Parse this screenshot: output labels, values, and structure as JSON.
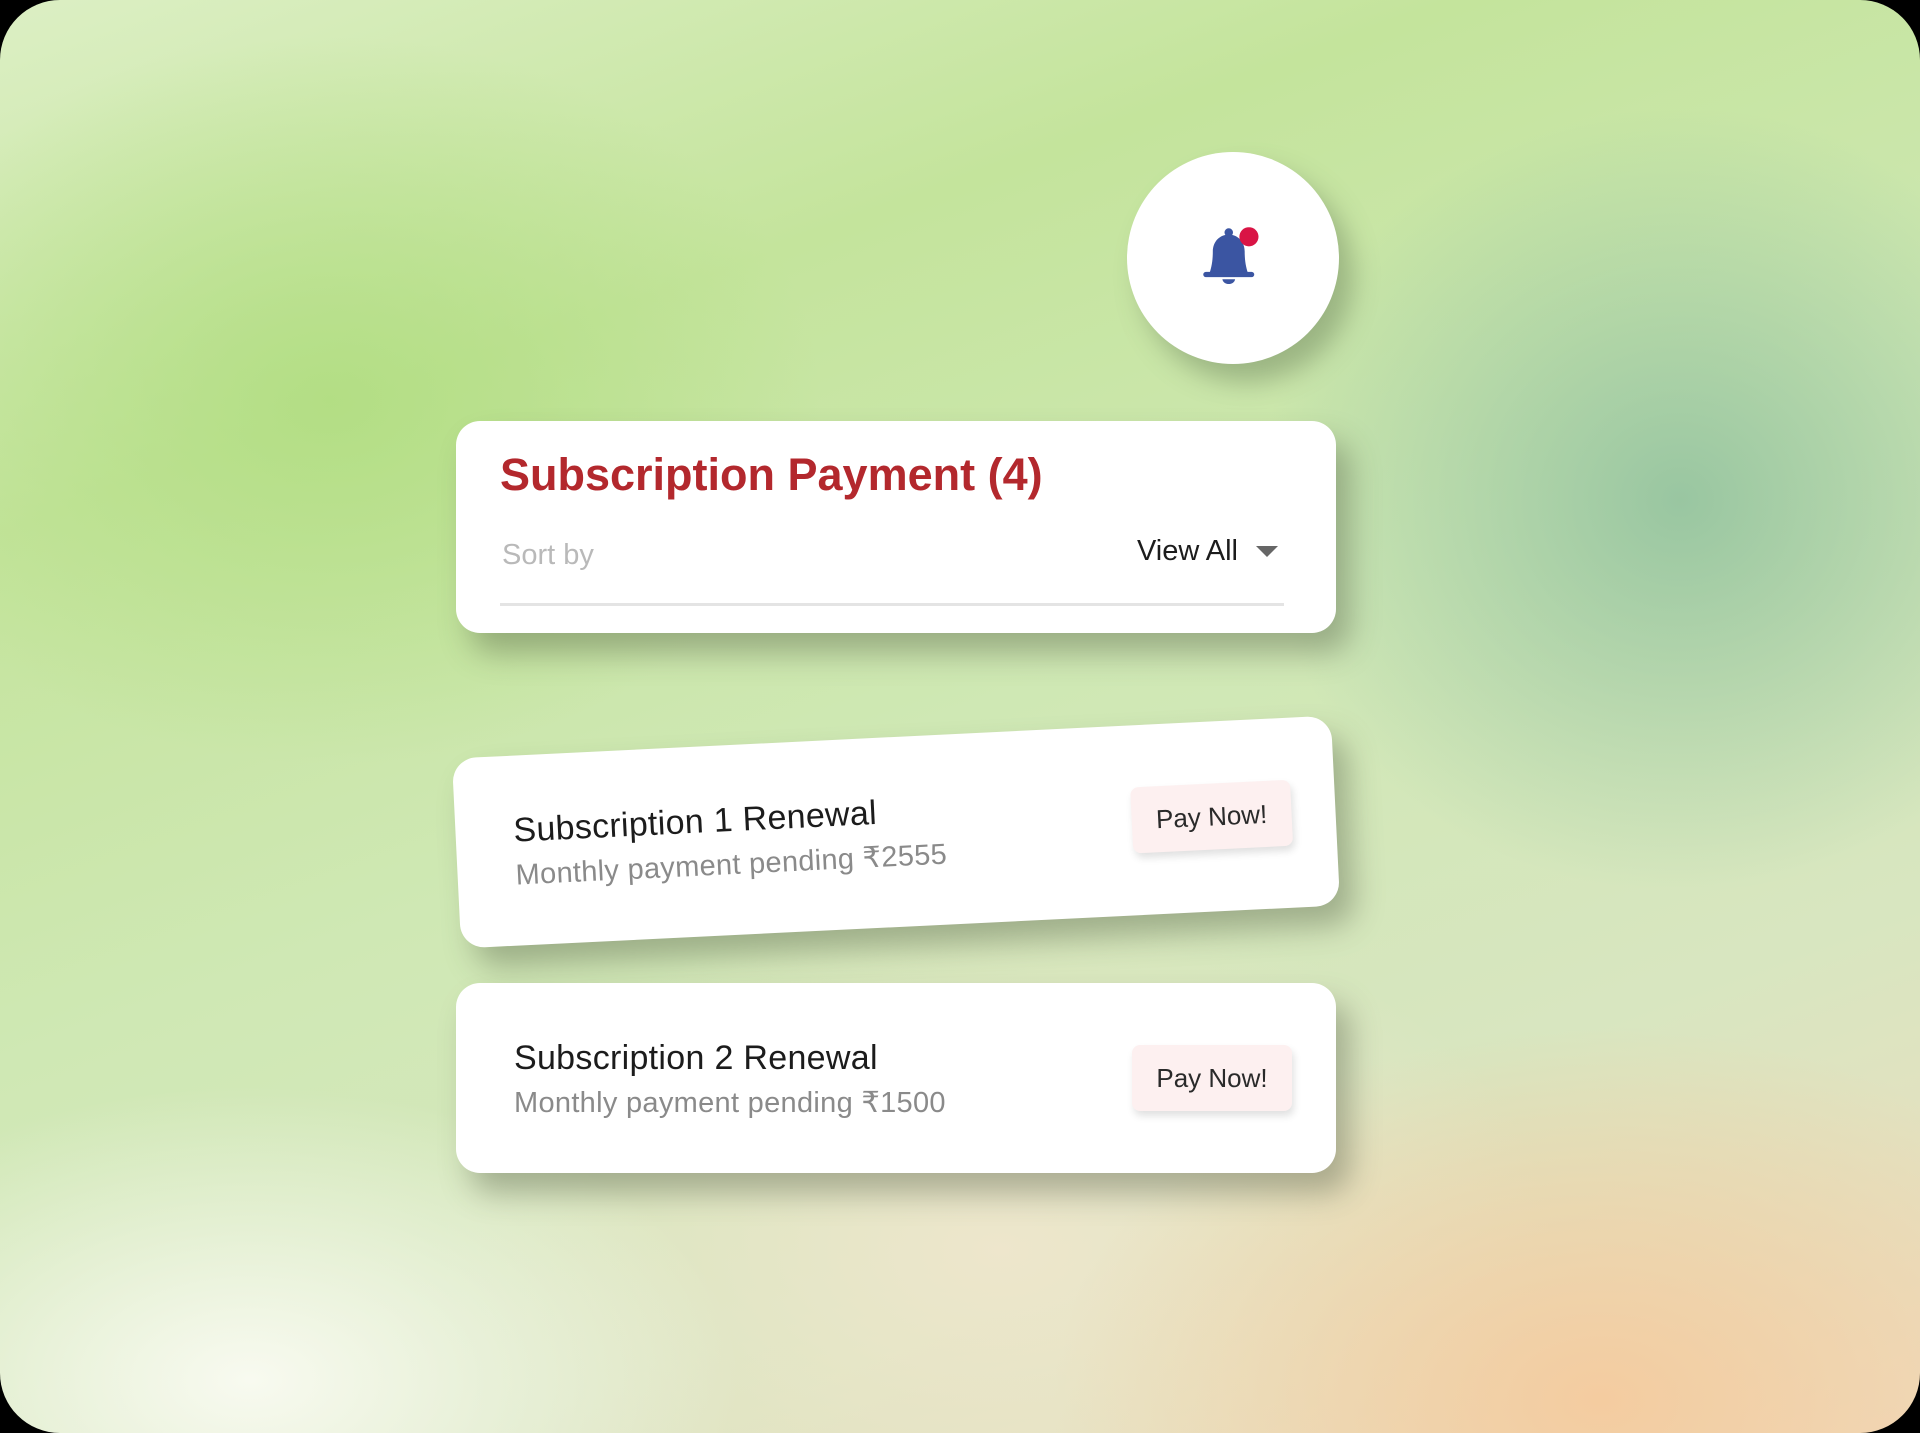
{
  "notification": {
    "icon": "bell-icon",
    "has_unread": true,
    "icon_color": "#3b55a2",
    "badge_color": "#d91445"
  },
  "header": {
    "title": "Subscription Payment (4)",
    "title_color": "#b3282d",
    "sort_label": "Sort by",
    "sort_value": "View All",
    "sort_icon": "caret-down-icon"
  },
  "subscriptions": [
    {
      "title": "Subscription 1 Renewal",
      "description": "Monthly payment pending ₹2555",
      "action_label": "Pay Now!"
    },
    {
      "title": "Subscription 2 Renewal",
      "description": "Monthly payment pending ₹1500",
      "action_label": "Pay Now!"
    }
  ]
}
